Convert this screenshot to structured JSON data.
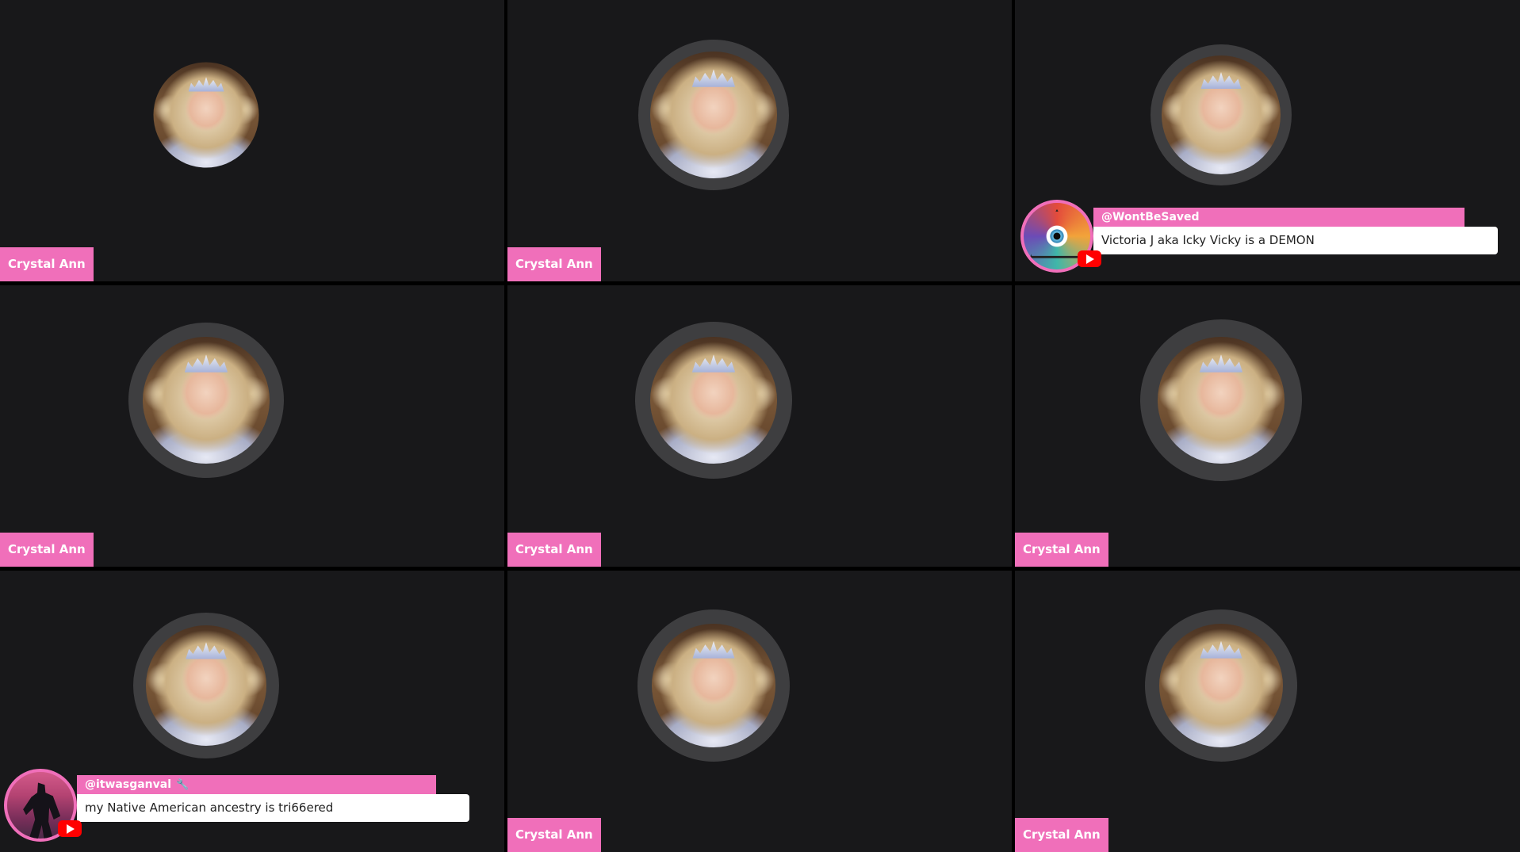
{
  "participants": [
    {
      "name": "Crystal Ann"
    },
    {
      "name": "Crystal Ann"
    },
    {
      "name": "Crystal Ann"
    },
    {
      "name": "Crystal Ann"
    },
    {
      "name": "Crystal Ann"
    },
    {
      "name": "Crystal Ann"
    },
    {
      "name": "Crystal Ann"
    },
    {
      "name": "Crystal Ann"
    },
    {
      "name": "Crystal Ann"
    }
  ],
  "chat_messages": [
    {
      "username": "@WontBeSaved",
      "message": "Victoria J aka Icky Vicky is a DEMON",
      "avatar_icon": "all-seeing-eye-icon",
      "platform_icon": "youtube-icon"
    },
    {
      "username": "@itwasganval",
      "username_badge": "🔧",
      "message": "my Native American ancestry is tri66ered",
      "avatar_icon": "warrior-silhouette-icon",
      "platform_icon": "youtube-icon"
    }
  ],
  "colors": {
    "accent_pink": "#f06fba",
    "tile_background": "#18181a",
    "avatar_ring": "#3e3e40",
    "youtube_red": "#ff0000"
  }
}
